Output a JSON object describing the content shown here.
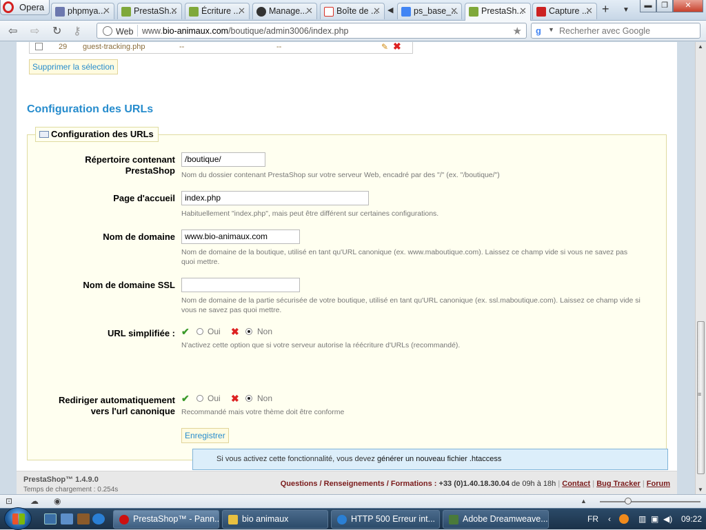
{
  "browser": {
    "menu_label": "Opera",
    "tabs": [
      {
        "label": "phpmya...",
        "icon_color": "#6c78af",
        "active": false
      },
      {
        "label": "PrestaSh...",
        "icon_color": "#7fa83a",
        "active": false
      },
      {
        "label": "Écriture ...",
        "icon_color": "#7fa83a",
        "active": false
      },
      {
        "label": "Manage...",
        "icon_color": "#333333",
        "active": false
      },
      {
        "label": "Boîte de ...",
        "icon_color": "#d93025",
        "active": false
      },
      {
        "label": "ps_base_...",
        "icon_color": "#4285f4",
        "active": false
      },
      {
        "label": "PrestaSh...",
        "icon_color": "#7fa83a",
        "active": true
      },
      {
        "label": "Capture ...",
        "icon_color": "#cc2222",
        "active": false
      }
    ],
    "address": {
      "mode_label": "Web",
      "url_prefix": "www.",
      "url_domain": "bio-animaux.com",
      "url_path": "/boutique/admin3006/index.php"
    },
    "search_placeholder": "Recherher avec Google"
  },
  "top_table": {
    "row": {
      "id": "29",
      "name": "guest-tracking.php",
      "col3": "--",
      "col4": "--"
    },
    "delete_selection_label": "Supprimer la sélection"
  },
  "section_title": "Configuration des URLs",
  "fieldset": {
    "legend": "Configuration des URLs",
    "fields": [
      {
        "label_line1": "Répertoire contenant",
        "label_line2": "PrestaShop",
        "value": "/boutique/",
        "hint": "Nom du dossier contenant PrestaShop sur votre serveur Web, encadré par des \"/\" (ex. \"/boutique/\")"
      },
      {
        "label_line1": "Page d'accueil",
        "label_line2": "",
        "value": "index.php",
        "hint": "Habituellement \"index.php\", mais peut être différent sur certaines configurations."
      },
      {
        "label_line1": "Nom de domaine",
        "label_line2": "",
        "value": "www.bio-animaux.com",
        "hint_line1": "Nom de domaine de la boutique, utilisé en tant qu'URL canonique (ex. www.maboutique.com). Laissez ce champ vide si vous ne savez pas",
        "hint_line2": "quoi mettre."
      },
      {
        "label_line1": "Nom de domaine SSL",
        "label_line2": "",
        "value": "",
        "hint_line1": "Nom de domaine de la partie sécurisée de votre boutique, utilisé en tant qu'URL canonique (ex. ssl.maboutique.com). Laissez ce champ vide si",
        "hint_line2": "vous ne savez pas quoi mettre."
      }
    ],
    "friendly_url": {
      "label": "URL simplifiée :",
      "yes": "Oui",
      "no": "Non",
      "selected": "Non",
      "hint": "N'activez cette option que si votre serveur autorise la réécriture d'URLs (recommandé).",
      "info_prefix": "Si vous activez cette fonctionnalité, vous devez ",
      "info_link": "générer un nouveau fichier .htaccess"
    },
    "canonical_redirect": {
      "label_line1": "Rediriger automatiquement",
      "label_line2": "vers l'url canonique",
      "yes": "Oui",
      "no": "Non",
      "selected": "Non",
      "hint": "Recommandé mais votre thème doit être conforme"
    },
    "save_label": "Enregistrer"
  },
  "footer": {
    "version": "PrestaShop™ 1.4.9.0",
    "load_time": "Temps de chargement : 0.254s",
    "contact_prefix": "Questions / Renseignements / Formations :",
    "phone": "+33 (0)1.40.18.30.04",
    "hours": "de 09h à 18h",
    "link_contact": "Contact",
    "link_bugtracker": "Bug Tracker",
    "link_forum": "Forum"
  },
  "taskbar": {
    "items": [
      {
        "label": "PrestaShop™ - Pann...",
        "icon_color": "#cc1111",
        "active": true
      },
      {
        "label": "bio animaux",
        "icon_color": "#e8c040",
        "active": false
      },
      {
        "label": "HTTP 500 Erreur int...",
        "icon_color": "#2a7fd4",
        "active": false
      },
      {
        "label": "Adobe Dreamweave...",
        "icon_color": "#4a7a3a",
        "active": false
      }
    ],
    "lang": "FR",
    "clock": "09:22"
  }
}
